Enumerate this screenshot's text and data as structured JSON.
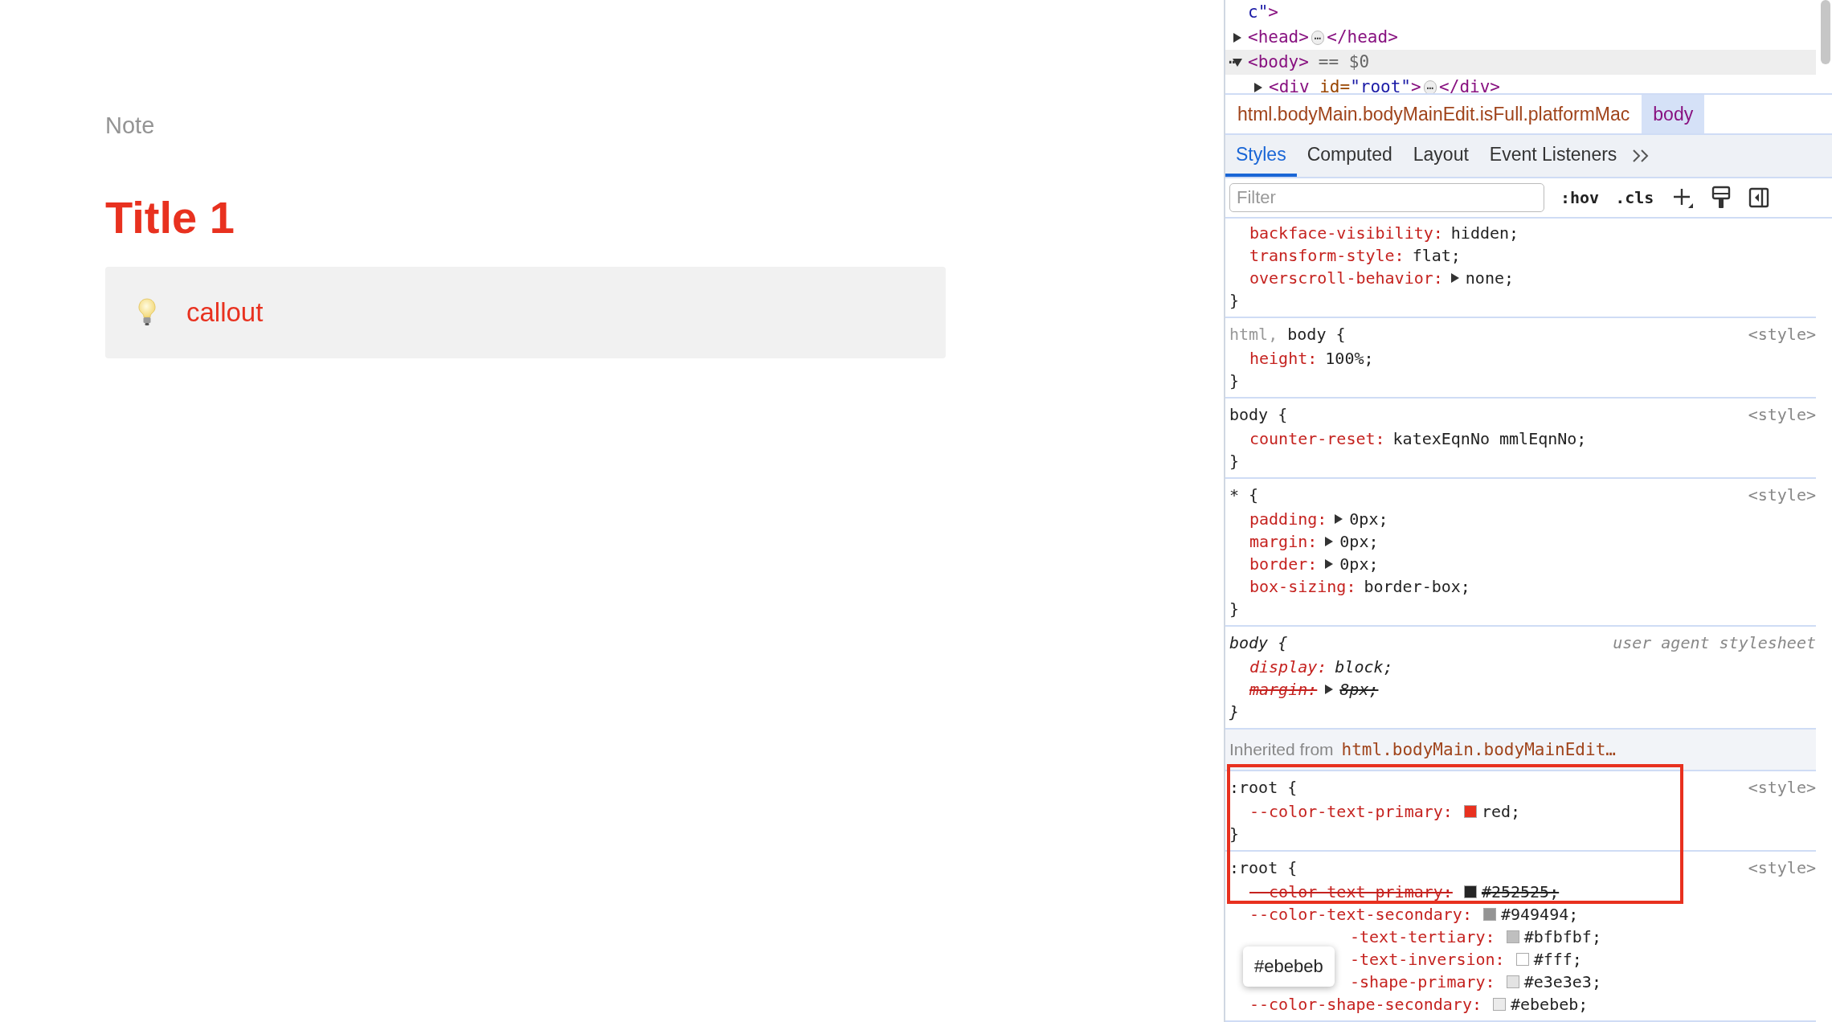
{
  "page": {
    "label": "Note",
    "title": "Title 1",
    "callout": {
      "text": "callout"
    }
  },
  "devtools": {
    "dom": [
      {
        "tokens": [
          {
            "text": "c\"",
            "kind": "value"
          },
          {
            "text": ">",
            "kind": "tag"
          }
        ]
      },
      {
        "tokens": [
          {
            "text": "<head>",
            "kind": "tag"
          },
          {
            "text": "⋯",
            "kind": "ellipsis"
          },
          {
            "text": "</head>",
            "kind": "tag"
          }
        ],
        "expanded": false,
        "selected": false
      },
      {
        "marker": "⋯",
        "tokens": [
          {
            "text": "<body>",
            "kind": "tag"
          },
          {
            "text": "== $0",
            "kind": "note"
          }
        ],
        "expanded": true,
        "selected": true,
        "children": [
          {
            "tokens": [
              {
                "text": "<div ",
                "kind": "tag"
              },
              {
                "text": "id=",
                "kind": "attr"
              },
              {
                "text": "\"root\"",
                "kind": "value"
              },
              {
                "text": ">",
                "kind": "tag"
              },
              {
                "text": "⋯",
                "kind": "ellipsis"
              },
              {
                "text": "</div>",
                "kind": "tag"
              }
            ],
            "expanded": false,
            "selected": false
          }
        ]
      }
    ],
    "breadcrumbs": [
      {
        "label": "html.bodyMain.bodyMainEdit.isFull.platformMac",
        "selected": false
      },
      {
        "label": "body",
        "selected": true
      }
    ],
    "tabs": [
      {
        "label": "Styles",
        "selected": true
      },
      {
        "label": "Computed",
        "selected": false
      },
      {
        "label": "Layout",
        "selected": false
      },
      {
        "label": "Event Listeners",
        "selected": false
      }
    ],
    "filter": {
      "placeholder": "Filter"
    },
    "toggles": [
      ":hov",
      ".cls"
    ],
    "rules": [
      {
        "kind": "rule",
        "props": [
          {
            "name": "backface-visibility:",
            "value": "hidden;"
          },
          {
            "name": "transform-style:",
            "value": "flat;"
          },
          {
            "name": "overscroll-behavior:",
            "value": "none;",
            "expandable": true
          }
        ],
        "close": "}"
      },
      {
        "kind": "rule",
        "selector": [
          {
            "text": "html,",
            "matched": false
          },
          {
            "text": "body {",
            "matched": true
          }
        ],
        "source": "<style>",
        "props": [
          {
            "name": "height:",
            "value": "100%;"
          }
        ],
        "close": "}"
      },
      {
        "kind": "rule",
        "selector": [
          {
            "text": "body {",
            "matched": true
          }
        ],
        "source": "<style>",
        "props": [
          {
            "name": "counter-reset:",
            "value": "katexEqnNo mmlEqnNo;"
          }
        ],
        "close": "}"
      },
      {
        "kind": "rule",
        "selector": [
          {
            "text": "* {",
            "matched": true
          }
        ],
        "source": "<style>",
        "props": [
          {
            "name": "padding:",
            "value": "0px;",
            "expandable": true
          },
          {
            "name": "margin:",
            "value": "0px;",
            "expandable": true
          },
          {
            "name": "border:",
            "value": "0px;",
            "expandable": true
          },
          {
            "name": "box-sizing:",
            "value": "border-box;"
          }
        ],
        "close": "}"
      },
      {
        "kind": "rule",
        "italic": true,
        "selector": [
          {
            "text": "body {",
            "matched": true
          }
        ],
        "source": "user agent stylesheet",
        "props": [
          {
            "name": "display:",
            "value": "block;"
          },
          {
            "name": "margin:",
            "value": "8px;",
            "expandable": true,
            "overridden": true
          }
        ],
        "close": "}"
      },
      {
        "kind": "inherited",
        "label": "Inherited from",
        "selector": "html.bodyMain.bodyMainEdit…"
      },
      {
        "kind": "rule",
        "selector": [
          {
            "text": ":root {",
            "matched": true
          }
        ],
        "source": "<style>",
        "props": [
          {
            "name": "--color-text-primary:",
            "value": "red;",
            "color": "#e8311f"
          }
        ],
        "close": "}"
      },
      {
        "kind": "rule",
        "selector": [
          {
            "text": ":root {",
            "matched": true
          }
        ],
        "source": "<style>",
        "props": [
          {
            "name": "--color-text-primary:",
            "value": "#252525;",
            "color": "#252525",
            "overridden": true
          },
          {
            "name": "--color-text-secondary:",
            "value": "#949494;",
            "color": "#949494"
          },
          {
            "name": "-text-tertiary:",
            "value": "#bfbfbf;",
            "color": "#bfbfbf",
            "covered": true
          },
          {
            "name": "-text-inversion:",
            "value": "#fff;",
            "color": "#ffffff",
            "covered": true
          },
          {
            "name": "-shape-primary:",
            "value": "#e3e3e3;",
            "color": "#e3e3e3",
            "covered": true
          },
          {
            "name": "--color-shape-secondary:",
            "value": "#ebebeb;",
            "color": "#ebebeb"
          }
        ]
      }
    ],
    "tooltip": "#ebebeb"
  }
}
